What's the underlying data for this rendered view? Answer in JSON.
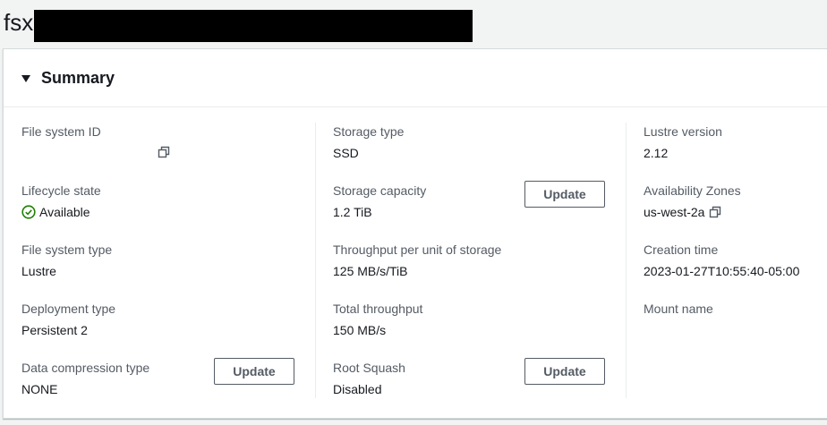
{
  "page": {
    "title_prefix": "fsx"
  },
  "summary": {
    "title": "Summary",
    "col1": {
      "file_system_id_label": "File system ID",
      "file_system_id_value": "",
      "lifecycle_label": "Lifecycle state",
      "lifecycle_value": "Available",
      "fs_type_label": "File system type",
      "fs_type_value": "Lustre",
      "deployment_label": "Deployment type",
      "deployment_value": "Persistent 2",
      "compression_label": "Data compression type",
      "compression_value": "NONE",
      "compression_update": "Update"
    },
    "col2": {
      "storage_type_label": "Storage type",
      "storage_type_value": "SSD",
      "capacity_label": "Storage capacity",
      "capacity_value": "1.2 TiB",
      "capacity_update": "Update",
      "throughput_unit_label": "Throughput per unit of storage",
      "throughput_unit_value": "125 MB/s/TiB",
      "total_throughput_label": "Total throughput",
      "total_throughput_value": "150 MB/s",
      "root_squash_label": "Root Squash",
      "root_squash_value": "Disabled",
      "root_squash_update": "Update"
    },
    "col3": {
      "lustre_version_label": "Lustre version",
      "lustre_version_value": "2.12",
      "az_label": "Availability Zones",
      "az_value": "us-west-2a",
      "creation_label": "Creation time",
      "creation_value": "2023-01-27T10:55:40-05:00",
      "mount_label": "Mount name",
      "mount_value": ""
    }
  },
  "colors": {
    "status_success": "#1d8102",
    "button_border": "#545b64"
  }
}
